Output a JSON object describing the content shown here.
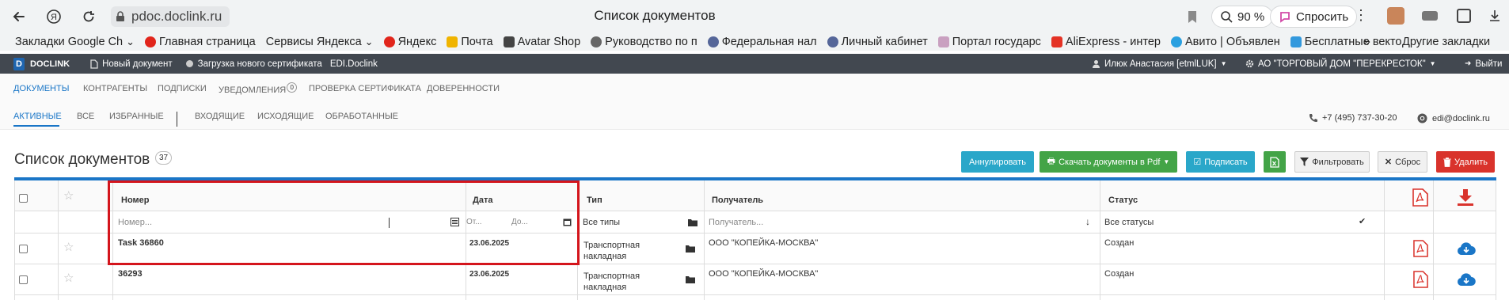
{
  "browser": {
    "url": "pdoc.doclink.ru",
    "tab_title": "Список документов",
    "zoom": "90 %",
    "ask_label": "Спросить",
    "bookmarks": [
      {
        "label": "Закладки Google Ch",
        "icon": "none",
        "chev": true
      },
      {
        "label": "Главная страница",
        "icon": "yandex",
        "chev": false
      },
      {
        "label": "Сервисы Яндекса",
        "icon": "none",
        "chev": true
      },
      {
        "label": "Яндекс",
        "icon": "yandex",
        "chev": false
      },
      {
        "label": "Почта",
        "icon": "mail",
        "chev": false
      },
      {
        "label": "Avatar Shop",
        "icon": "shop",
        "chev": false
      },
      {
        "label": "Руководство по п",
        "icon": "gear",
        "chev": false
      },
      {
        "label": "Федеральная нал",
        "icon": "emblem",
        "chev": false
      },
      {
        "label": "Личный кабинет",
        "icon": "emblem",
        "chev": false
      },
      {
        "label": "Портал государс",
        "icon": "gos",
        "chev": false
      },
      {
        "label": "AliExpress - интер",
        "icon": "ali",
        "chev": false
      },
      {
        "label": "Авито | Объявлен",
        "icon": "avito",
        "chev": false
      },
      {
        "label": "Бесплатные векто",
        "icon": "vector",
        "chev": false
      }
    ],
    "bookmarks_more": "»",
    "other_bookmarks": "Другие закладки"
  },
  "header": {
    "brand": "DOCLINK",
    "logo_letter": "D",
    "new_doc": "Новый документ",
    "upload_cert": "Загрузка нового сертификата",
    "edi": "EDI.Doclink",
    "user": "Илюк Анастасия [etmlLUK]",
    "company": "АО \"ТОРГОВЫЙ ДОМ \"ПЕРЕКРЕСТОК\"",
    "logout": "Выйти"
  },
  "nav": {
    "main": [
      "ДОКУМЕНТЫ",
      "КОНТРАГЕНТЫ",
      "ПОДПИСКИ",
      "УВЕДОМЛЕНИЯ",
      "ПРОВЕРКА СЕРТИФИКАТА",
      "ДОВЕРЕННОСТИ"
    ],
    "notifications_count": "0",
    "sub": [
      "АКТИВНЫЕ",
      "ВСЕ",
      "ИЗБРАННЫЕ",
      "ВХОДЯЩИЕ",
      "ИСХОДЯЩИЕ",
      "ОБРАБОТАННЫЕ"
    ],
    "phone": "+7 (495) 737-30-20",
    "email": "edi@doclink.ru"
  },
  "page": {
    "title": "Список документов",
    "count": "37"
  },
  "toolbar": {
    "annul": "Аннулировать",
    "download_pdf": "Скачать документы в Pdf",
    "sign": "Подписать",
    "filter": "Фильтровать",
    "reset": "Сброс",
    "delete": "Удалить",
    "colors": {
      "annul": "#2aa7c9",
      "download": "#43a447",
      "sign": "#2aa7c9",
      "excel": "#43a447",
      "delete": "#d9332c"
    }
  },
  "table": {
    "headers": {
      "number": "Номер",
      "date": "Дата",
      "type": "Тип",
      "recipient": "Получатель",
      "status": "Статус"
    },
    "filters": {
      "number": "Номер...",
      "date_from": "От...",
      "date_to": "До...",
      "type": "Все типы",
      "recipient": "Получатель...",
      "status": "Все статусы"
    },
    "rows": [
      {
        "number": "Task 36860",
        "date": "23.06.2025",
        "type_line1": "Транспортная",
        "type_line2": "накладная",
        "recipient": "ООО \"КОПЕЙКА-МОСКВА\"",
        "status": "Создан"
      },
      {
        "number": "36293",
        "date": "23.06.2025",
        "type_line1": "Транспортная",
        "type_line2": "накладная",
        "recipient": "ООО \"КОПЕЙКА-МОСКВА\"",
        "status": "Создан"
      }
    ]
  }
}
